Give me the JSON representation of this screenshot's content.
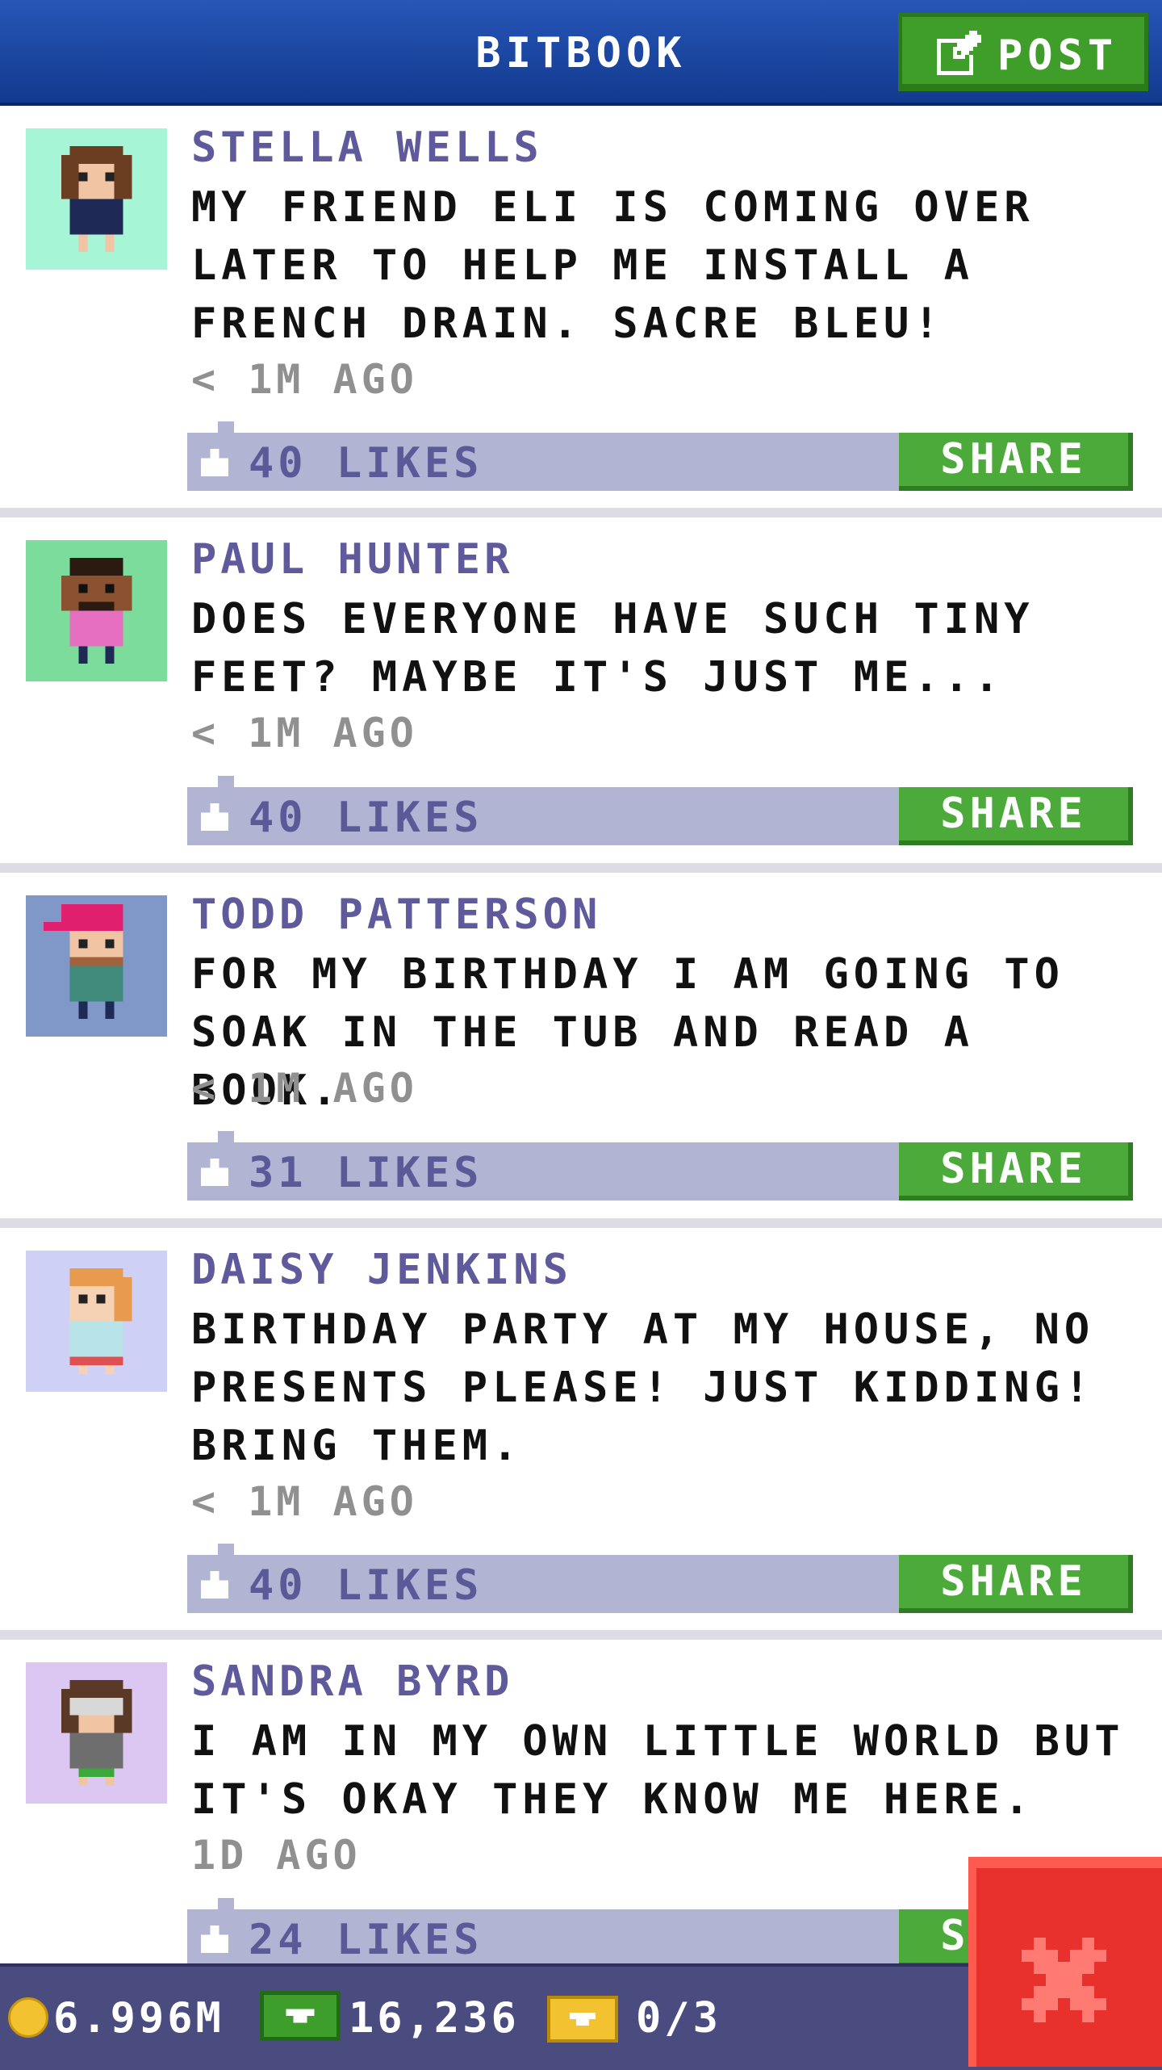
{
  "header": {
    "title": "BITBOOK",
    "post_label": "POST"
  },
  "posts": [
    {
      "name": "STELLA WELLS",
      "text": "MY FRIEND ELI IS COMING OVER LATER TO HELP ME INSTALL A FRENCH DRAIN. SACRE BLEU!",
      "time": "< 1M AGO",
      "likes": "40 LIKES",
      "share": "SHARE",
      "avatar_bg": "#a6f5d6"
    },
    {
      "name": "PAUL HUNTER",
      "text": "DOES EVERYONE HAVE SUCH TINY FEET? MAYBE IT'S JUST ME...",
      "time": "< 1M AGO",
      "likes": "40 LIKES",
      "share": "SHARE",
      "avatar_bg": "#7cdc9c"
    },
    {
      "name": "TODD PATTERSON",
      "text": "FOR MY BIRTHDAY I AM GOING TO SOAK IN THE TUB AND READ A BOOK.",
      "time": "< 1M AGO",
      "likes": "31 LIKES",
      "share": "SHARE",
      "avatar_bg": "#7f98c8"
    },
    {
      "name": "DAISY JENKINS",
      "text": "BIRTHDAY PARTY AT MY HOUSE, NO PRESENTS PLEASE! JUST KIDDING! BRING THEM.",
      "time": "< 1M AGO",
      "likes": "40 LIKES",
      "share": "SHARE",
      "avatar_bg": "#cfd0f6"
    },
    {
      "name": "SANDRA BYRD",
      "text": "I AM IN MY OWN LITTLE WORLD BUT IT'S OKAY THEY KNOW ME HERE.",
      "time": "1D AGO",
      "likes": "24 LIKES",
      "share": "SHARE",
      "avatar_bg": "#dcc6f2"
    }
  ],
  "footer": {
    "coins": "6.996M",
    "bux": "16,236",
    "tickets": "0/3"
  },
  "icons": {
    "post": "edit-icon",
    "like": "thumbs-up-icon",
    "coin": "coin-icon",
    "bux": "bux-icon",
    "ticket": "ticket-icon",
    "close": "close-icon"
  },
  "colors": {
    "header": "#1d4aa6",
    "green": "#4caa3a",
    "like_bar": "#b2b4d4",
    "close": "#e8302c"
  }
}
